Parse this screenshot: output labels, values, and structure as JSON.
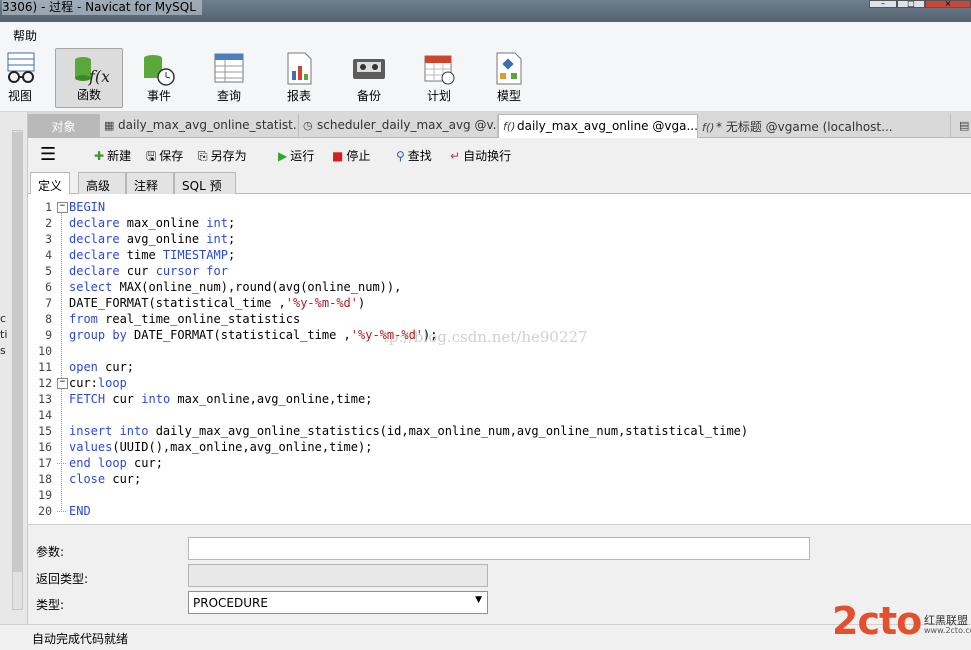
{
  "window": {
    "title": "3306) - 过程 - Navicat for MySQL"
  },
  "menu": {
    "help": "帮助"
  },
  "ribbon": [
    {
      "label": "视图",
      "icon": "view-glasses-icon"
    },
    {
      "label": "函数",
      "icon": "function-fx-icon",
      "active": true
    },
    {
      "label": "事件",
      "icon": "event-clock-icon"
    },
    {
      "label": "查询",
      "icon": "query-table-icon"
    },
    {
      "label": "报表",
      "icon": "report-chart-icon"
    },
    {
      "label": "备份",
      "icon": "backup-tape-icon"
    },
    {
      "label": "计划",
      "icon": "schedule-calendar-icon"
    },
    {
      "label": "模型",
      "icon": "model-diagram-icon"
    }
  ],
  "tabs": {
    "objects": "对象",
    "items": [
      {
        "label": "daily_max_avg_online_statist...",
        "icon": "table-icon"
      },
      {
        "label": "scheduler_daily_max_avg @v...",
        "icon": "event-icon"
      },
      {
        "label": "daily_max_avg_online @vga...",
        "icon": "procedure-icon",
        "current": true
      },
      {
        "label": "* 无标题 @vgame (localhost...",
        "icon": "procedure-icon"
      }
    ]
  },
  "left_fragments": [
    "c",
    "ti",
    "s"
  ],
  "toolbar": {
    "new": "新建",
    "save": "保存",
    "save_as": "另存为",
    "run": "运行",
    "stop": "停止",
    "find": "查找",
    "wrap": "自动换行"
  },
  "subtabs": [
    "定义",
    "高级",
    "注释",
    "SQL 预览"
  ],
  "editor": {
    "lines": [
      {
        "n": "1",
        "parts": [
          {
            "t": "BEGIN",
            "c": "kw"
          }
        ]
      },
      {
        "n": "2",
        "parts": [
          {
            "t": "declare ",
            "c": "kw"
          },
          {
            "t": "max_online ",
            "c": ""
          },
          {
            "t": "int",
            "c": "kw"
          },
          {
            "t": ";",
            "c": ""
          }
        ]
      },
      {
        "n": "3",
        "parts": [
          {
            "t": "declare ",
            "c": "kw"
          },
          {
            "t": "avg_online ",
            "c": ""
          },
          {
            "t": "int",
            "c": "kw"
          },
          {
            "t": ";",
            "c": ""
          }
        ]
      },
      {
        "n": "4",
        "parts": [
          {
            "t": "declare ",
            "c": "kw"
          },
          {
            "t": "time ",
            "c": ""
          },
          {
            "t": "TIMESTAMP",
            "c": "kw"
          },
          {
            "t": ";",
            "c": ""
          }
        ]
      },
      {
        "n": "5",
        "parts": [
          {
            "t": "declare ",
            "c": "kw"
          },
          {
            "t": "cur ",
            "c": ""
          },
          {
            "t": "cursor for",
            "c": "kw"
          }
        ]
      },
      {
        "n": "6",
        "parts": [
          {
            "t": "select ",
            "c": "kw"
          },
          {
            "t": "MAX(online_num),round(avg(online_num)),",
            "c": ""
          }
        ]
      },
      {
        "n": "7",
        "parts": [
          {
            "t": "DATE_FORMAT(statistical_time ,",
            "c": ""
          },
          {
            "t": "'%y-%m-%d'",
            "c": "str"
          },
          {
            "t": ")",
            "c": ""
          }
        ]
      },
      {
        "n": "8",
        "parts": [
          {
            "t": "from ",
            "c": "kw"
          },
          {
            "t": "real_time_online_statistics",
            "c": ""
          }
        ]
      },
      {
        "n": "9",
        "parts": [
          {
            "t": "group by ",
            "c": "kw"
          },
          {
            "t": "DATE_FORMAT(statistical_time ,",
            "c": ""
          },
          {
            "t": "'%y-%m-%d'",
            "c": "str"
          },
          {
            "t": ");",
            "c": ""
          }
        ]
      },
      {
        "n": "10",
        "parts": []
      },
      {
        "n": "11",
        "parts": [
          {
            "t": "open ",
            "c": "kw"
          },
          {
            "t": "cur;",
            "c": ""
          }
        ]
      },
      {
        "n": "12",
        "parts": [
          {
            "t": "cur:",
            "c": ""
          },
          {
            "t": "loop",
            "c": "kw"
          }
        ]
      },
      {
        "n": "13",
        "parts": [
          {
            "t": "FETCH ",
            "c": "kw"
          },
          {
            "t": "cur ",
            "c": ""
          },
          {
            "t": "into ",
            "c": "kw"
          },
          {
            "t": "max_online,avg_online,time;",
            "c": ""
          }
        ]
      },
      {
        "n": "14",
        "parts": []
      },
      {
        "n": "15",
        "parts": [
          {
            "t": "insert into ",
            "c": "kw"
          },
          {
            "t": "daily_max_avg_online_statistics(id,max_online_num,avg_online_num,statistical_time)",
            "c": ""
          }
        ]
      },
      {
        "n": "16",
        "parts": [
          {
            "t": "values",
            "c": "kw"
          },
          {
            "t": "(UUID(),max_online,avg_online,time);",
            "c": ""
          }
        ]
      },
      {
        "n": "17",
        "parts": [
          {
            "t": "end loop ",
            "c": "kw"
          },
          {
            "t": "cur;",
            "c": ""
          }
        ]
      },
      {
        "n": "18",
        "parts": [
          {
            "t": "close ",
            "c": "kw"
          },
          {
            "t": "cur;",
            "c": ""
          }
        ]
      },
      {
        "n": "19",
        "parts": []
      },
      {
        "n": "20",
        "parts": [
          {
            "t": "END",
            "c": "kw"
          }
        ]
      }
    ],
    "watermark": "tp://blog.csdn.net/he90227"
  },
  "props": {
    "params_label": "参数:",
    "params_value": "",
    "return_label": "返回类型:",
    "type_label": "类型:",
    "type_value": "PROCEDURE"
  },
  "status": "自动完成代码就绪",
  "logo": {
    "big": "2cto",
    "small": "红黑联盟",
    "small2": "www.2cto.com"
  },
  "colors": {
    "keyword": "#2b49d8",
    "string": "#b11c1c",
    "logo": "#e4502b"
  }
}
